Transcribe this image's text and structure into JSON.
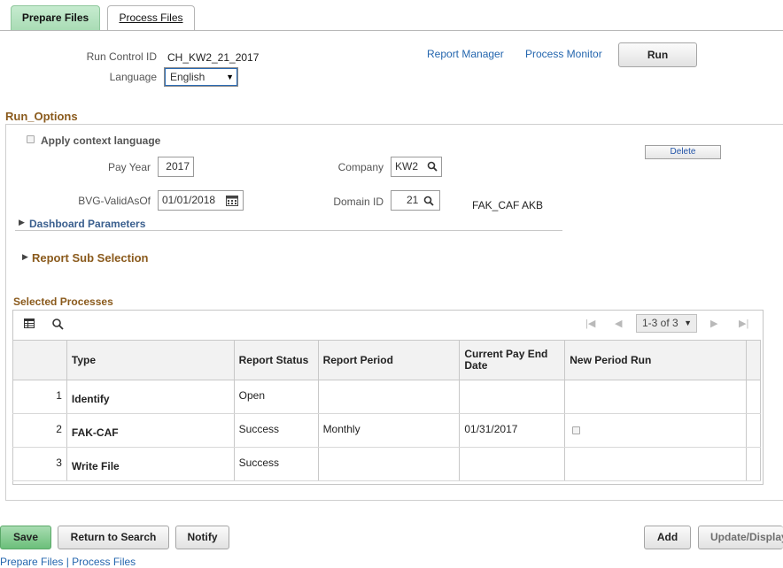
{
  "tabs": [
    {
      "label": "Prepare Files"
    },
    {
      "label": "Process Files"
    }
  ],
  "header": {
    "run_control_label": "Run Control ID",
    "run_control_value": "CH_KW2_21_2017",
    "language_label": "Language",
    "language_value": "English",
    "report_manager": "Report Manager",
    "process_monitor": "Process Monitor",
    "run_button": "Run"
  },
  "run_options": {
    "title": "Run_Options",
    "apply_context_language": "Apply context language",
    "pay_year_label": "Pay Year",
    "pay_year_value": "2017",
    "company_label": "Company",
    "company_value": "KW2",
    "bvg_label": "BVG-ValidAsOf",
    "bvg_value": "01/01/2018",
    "domain_label": "Domain ID",
    "domain_value": "21",
    "domain_description": "FAK_CAF AKB",
    "delete_button": "Delete",
    "dashboard_parameters": "Dashboard Parameters",
    "report_sub_selection": "Report Sub Selection"
  },
  "selected_processes": {
    "title": "Selected Processes",
    "pager": "1-3 of 3",
    "columns": [
      "",
      "Type",
      "Report Status",
      "Report Period",
      "Current Pay End Date",
      "New Period Run"
    ],
    "rows": [
      {
        "num": "1",
        "type": "Identify",
        "status": "Open",
        "period": "",
        "pay_end": "",
        "new_period_run": null
      },
      {
        "num": "2",
        "type": "FAK-CAF",
        "status": "Success",
        "period": "Monthly",
        "pay_end": "01/31/2017",
        "new_period_run": false
      },
      {
        "num": "3",
        "type": "Write File",
        "status": "Success",
        "period": "",
        "pay_end": "",
        "new_period_run": null
      }
    ]
  },
  "footer": {
    "save": "Save",
    "return_to_search": "Return to Search",
    "notify": "Notify",
    "add": "Add",
    "update_display": "Update/Display",
    "links": "Prepare Files | Process Files"
  },
  "icons": {
    "lookup": "magnifier-icon",
    "calendar": "calendar-icon",
    "grid_personalize": "grid-settings-icon",
    "grid_find": "search-icon"
  }
}
